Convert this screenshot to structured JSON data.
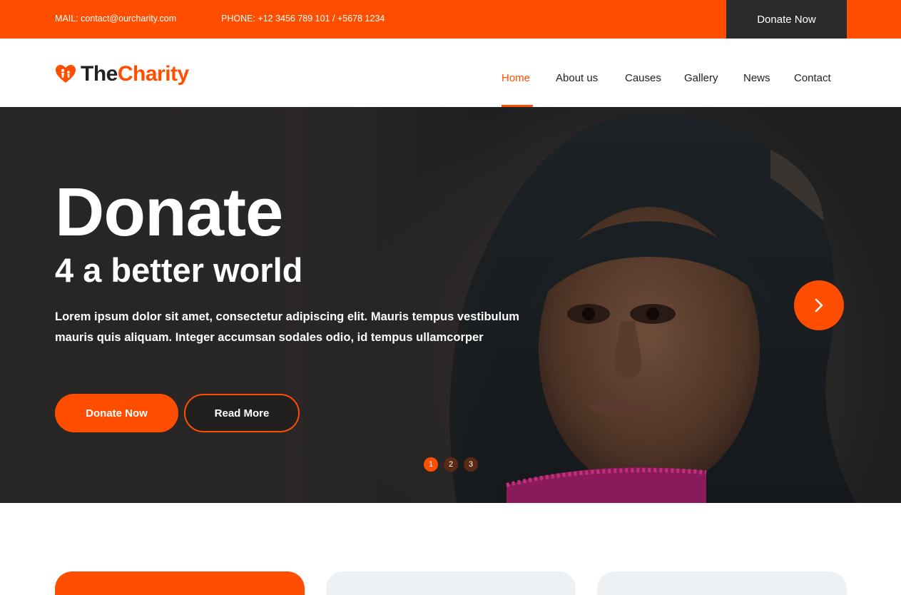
{
  "topbar": {
    "mail": "MAIL: contact@ourcharity.com",
    "phone": "PHONE: +12 3456 789 101 / +5678 1234",
    "donate_label": "Donate Now"
  },
  "brand": {
    "name_part1": "The",
    "name_part2": "Charity",
    "accent_color": "#ff4e00"
  },
  "nav": {
    "items": [
      {
        "label": "Home",
        "active": true
      },
      {
        "label": "About us"
      },
      {
        "label": "Causes"
      },
      {
        "label": "Gallery"
      },
      {
        "label": "News"
      },
      {
        "label": "Contact"
      }
    ]
  },
  "hero": {
    "title": "Donate",
    "subtitle": "4 a better world",
    "text": "Lorem ipsum dolor sit amet, consectetur adipiscing elit. Mauris tempus vestibulum mauris quis aliquam. Integer accumsan sodales odio, id tempus ullamcorper",
    "primary_button": "Donate Now",
    "secondary_button": "Read More",
    "next_icon": "chevron-right-icon",
    "slides": [
      "1",
      "2",
      "3"
    ],
    "active_slide": "1"
  }
}
